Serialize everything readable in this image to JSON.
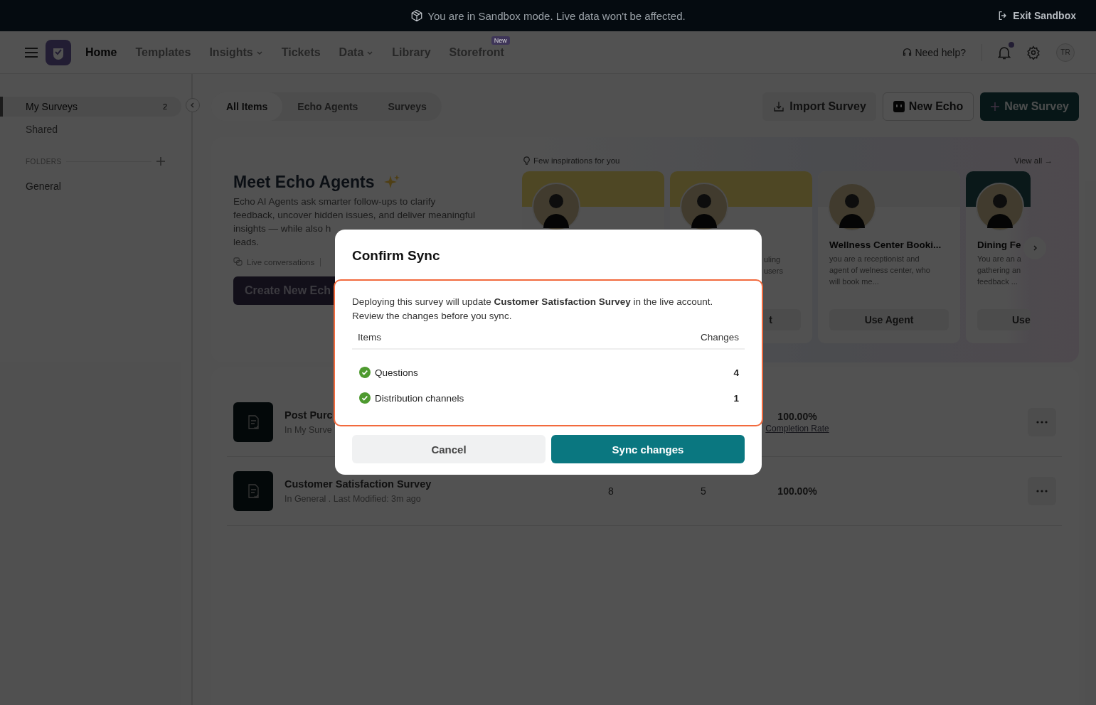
{
  "banner": {
    "message": "You are in Sandbox mode. Live data won't be affected.",
    "exit": "Exit Sandbox"
  },
  "nav": {
    "items": [
      {
        "label": "Home",
        "selected": true,
        "dropdown": false
      },
      {
        "label": "Templates",
        "selected": false,
        "dropdown": false
      },
      {
        "label": "Insights",
        "selected": false,
        "dropdown": true
      },
      {
        "label": "Tickets",
        "selected": false,
        "dropdown": false
      },
      {
        "label": "Data",
        "selected": false,
        "dropdown": true
      },
      {
        "label": "Library",
        "selected": false,
        "dropdown": false
      },
      {
        "label": "Storefront",
        "selected": false,
        "dropdown": false,
        "badge": "New"
      }
    ],
    "help": "Need help?",
    "notification_dot": true,
    "avatar": "TR"
  },
  "sidebar": {
    "items": [
      {
        "label": "My Surveys",
        "count": "2",
        "selected": true
      },
      {
        "label": "Shared",
        "selected": false
      }
    ],
    "folders_heading": "FOLDERS",
    "folders": [
      "General"
    ]
  },
  "tabs": [
    {
      "label": "All Items",
      "selected": true
    },
    {
      "label": "Echo Agents",
      "selected": false
    },
    {
      "label": "Surveys",
      "selected": false
    }
  ],
  "actions": [
    {
      "kind": "import",
      "label": "Import Survey"
    },
    {
      "kind": "echo",
      "label": "New Echo"
    },
    {
      "kind": "primary",
      "label": "New Survey"
    }
  ],
  "hero": {
    "title": "Meet Echo Agents",
    "description_lines": [
      "Echo AI Agents ask smarter follow-ups to clarify",
      "feedback, uncover hidden issues, and deliver meaningful",
      "insights — while also h",
      "leads."
    ],
    "meta": "Live conversations",
    "cta": "Create New Ech"
  },
  "inspirations": {
    "heading": "Few inspirations for you",
    "view_all": "View all →",
    "cards": [
      {
        "kind": "highlight"
      },
      {
        "kind": "highlight",
        "description_lines": [
          "uling",
          "users"
        ],
        "button": "t"
      },
      {
        "kind": "plain",
        "title": "Wellness Center Booki...",
        "description_lines": [
          "you are a receptionist and",
          "agent of welness center, who",
          "will book me..."
        ],
        "button": "Use Agent"
      },
      {
        "kind": "dark",
        "title": "Dining Fe",
        "description_lines": [
          "You are an a",
          "gathering an",
          "feedback ..."
        ],
        "button": "Use"
      }
    ]
  },
  "surveys": [
    {
      "title": "Post Purc",
      "subtitle": "In My Surve",
      "rate": "100.00%",
      "rate_label": "Completion Rate"
    },
    {
      "title": "Customer Satisfaction Survey",
      "subtitle": "In General . Last Modified: 3m ago",
      "column_2": "8",
      "column_3": "5",
      "rate": "100.00%"
    }
  ],
  "modal": {
    "title": "Confirm Sync",
    "message_lines": [
      "Deploying this survey will update **Customer Satisfaction Survey** in the live account.",
      "Review the changes before you sync."
    ],
    "columns": [
      "Items",
      "Changes"
    ],
    "rows": [
      {
        "label": "Questions",
        "count": "4",
        "done": true
      },
      {
        "label": "Distribution channels",
        "count": "1",
        "done": true
      }
    ],
    "cancel": "Cancel",
    "confirm": "Sync changes"
  }
}
